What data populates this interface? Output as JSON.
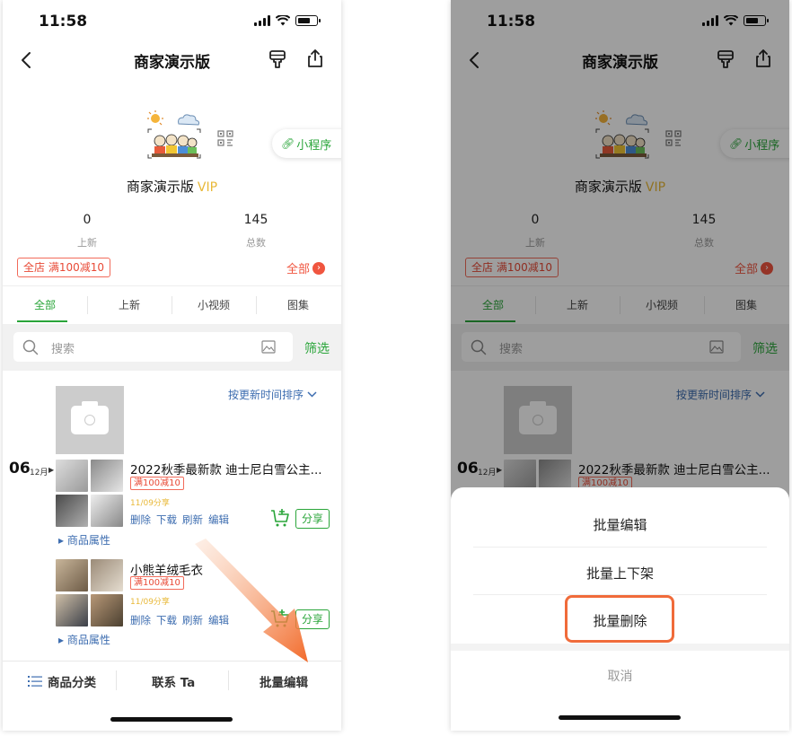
{
  "status": {
    "time": "11:58"
  },
  "nav": {
    "title": "商家演示版"
  },
  "shop": {
    "name": "商家演示版",
    "vip": "VIP",
    "mini_program": "小程序",
    "stats": [
      {
        "value": "0",
        "label": "上新"
      },
      {
        "value": "145",
        "label": "总数"
      }
    ],
    "promo": "全店 满100减10",
    "all_link": "全部"
  },
  "tabs": [
    "全部",
    "上新",
    "小视频",
    "图集"
  ],
  "search": {
    "placeholder": "搜索",
    "filter": "筛选"
  },
  "sort_label": "按更新时间排序",
  "date": {
    "day": "06",
    "month": "12月"
  },
  "products": [
    {
      "title": "2022秋季最新款 迪士尼白雪公主...",
      "promo": "满100减10",
      "share_count": "11/09分享",
      "actions": [
        "删除",
        "下载",
        "刷新",
        "编辑"
      ],
      "share_button": "分享",
      "attr": "商品属性"
    },
    {
      "title": "小熊羊绒毛衣",
      "promo": "满100减10",
      "share_count": "11/09分享",
      "actions": [
        "删除",
        "下载",
        "刷新",
        "编辑"
      ],
      "share_button": "分享",
      "attr": "商品属性"
    }
  ],
  "bottom_bar": {
    "category": "商品分类",
    "contact": "联系 Ta",
    "batch_edit": "批量编辑"
  },
  "action_sheet": {
    "items": [
      "批量编辑",
      "批量上下架",
      "批量删除"
    ],
    "cancel": "取消"
  },
  "colors": {
    "accent_green": "#2aa53a",
    "promo_red": "#e84a36",
    "link_blue": "#3d6db0",
    "highlight_orange": "#f06b3a",
    "vip_gold": "#e8b838"
  }
}
